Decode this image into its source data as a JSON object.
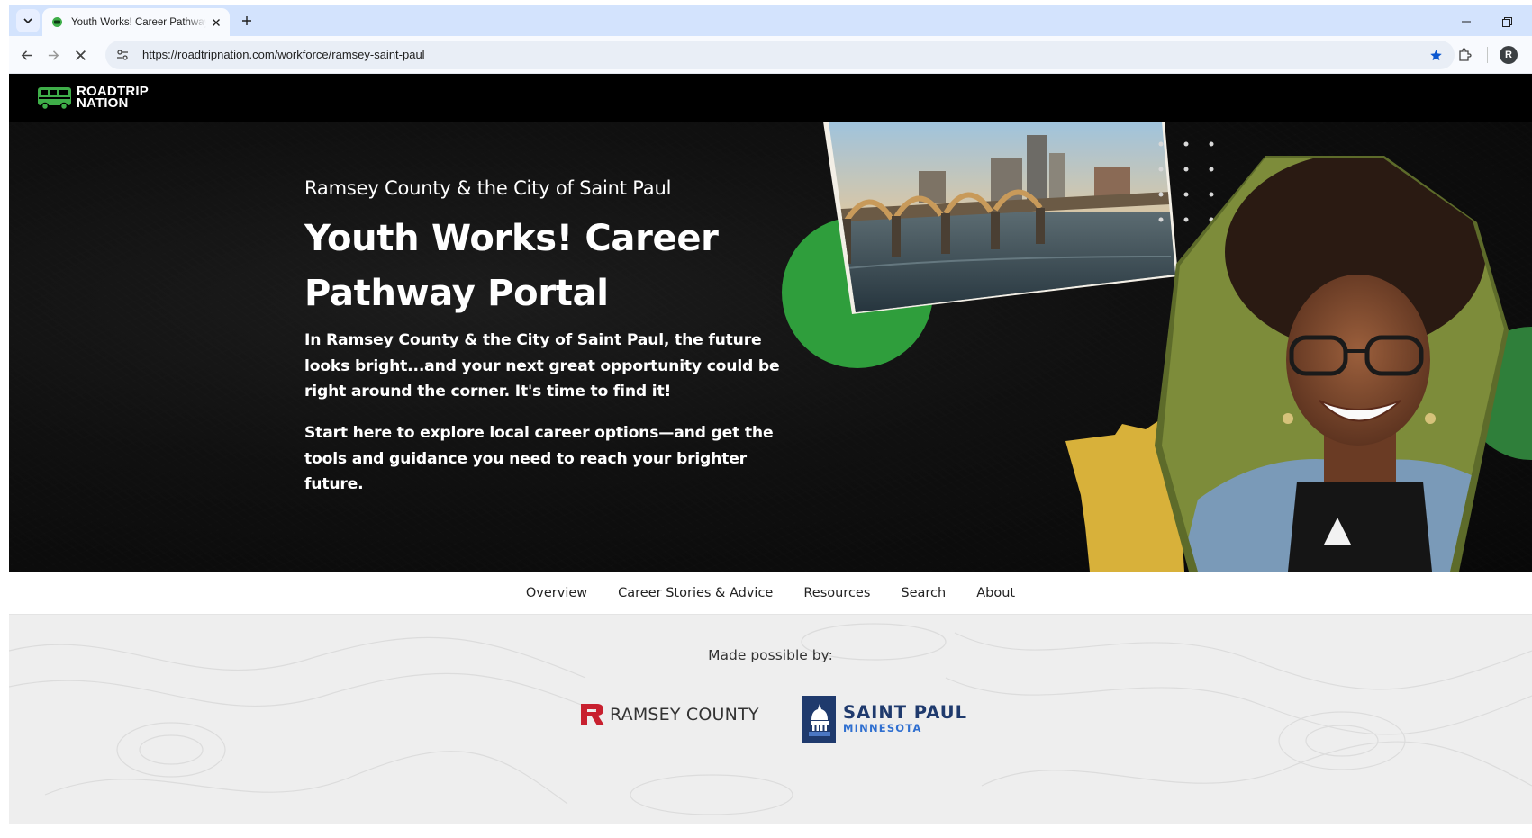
{
  "browser": {
    "tab": {
      "title": "Youth Works! Career Pathway Portal",
      "favicon": "roadtrip-nation-favicon"
    },
    "url": "https://roadtripnation.com/workforce/ramsey-saint-paul",
    "profile_initial": "R",
    "icons": [
      "tab-list-icon",
      "close-icon",
      "plus-icon",
      "minimize-icon",
      "restore-icon",
      "back-arrow-icon",
      "forward-arrow-icon",
      "stop-loading-icon",
      "site-settings-icon",
      "bookmark-star-icon",
      "extensions-icon"
    ],
    "colors": {
      "tabstrip": "#d3e3fd",
      "toolbar": "#f8fafe",
      "omnibox": "#e9eef6",
      "star": "#0b57d0"
    }
  },
  "site": {
    "logo": {
      "line1": "ROADTRIP",
      "line2": "NATION",
      "accent": "#3fae49"
    },
    "hero": {
      "subtitle": "Ramsey County & the City of Saint Paul",
      "title": "Youth Works! Career Pathway Portal",
      "paragraph1": "In Ramsey County & the City of Saint Paul, the future looks bright...and your next great opportunity could be right around the corner. It's time to find it!",
      "paragraph2": "Start here to explore local career options—and get the tools and guidance you need to reach your brighter future.",
      "colors": {
        "green": "#2f9e3c",
        "gold": "#d8b13a",
        "background": "#0b0b0b"
      }
    },
    "nav": {
      "items": [
        {
          "label": "Overview"
        },
        {
          "label": "Career Stories & Advice"
        },
        {
          "label": "Resources"
        },
        {
          "label": "Search"
        },
        {
          "label": "About"
        }
      ]
    },
    "sponsors": {
      "heading": "Made possible by:",
      "ramsey": {
        "text": "RAMSEY COUNTY",
        "mark_color": "#c8202f"
      },
      "saint_paul": {
        "name": "SAINT PAUL",
        "state": "MINNESOTA",
        "navy": "#1f3a6d",
        "blue": "#2f6fd0"
      }
    }
  }
}
